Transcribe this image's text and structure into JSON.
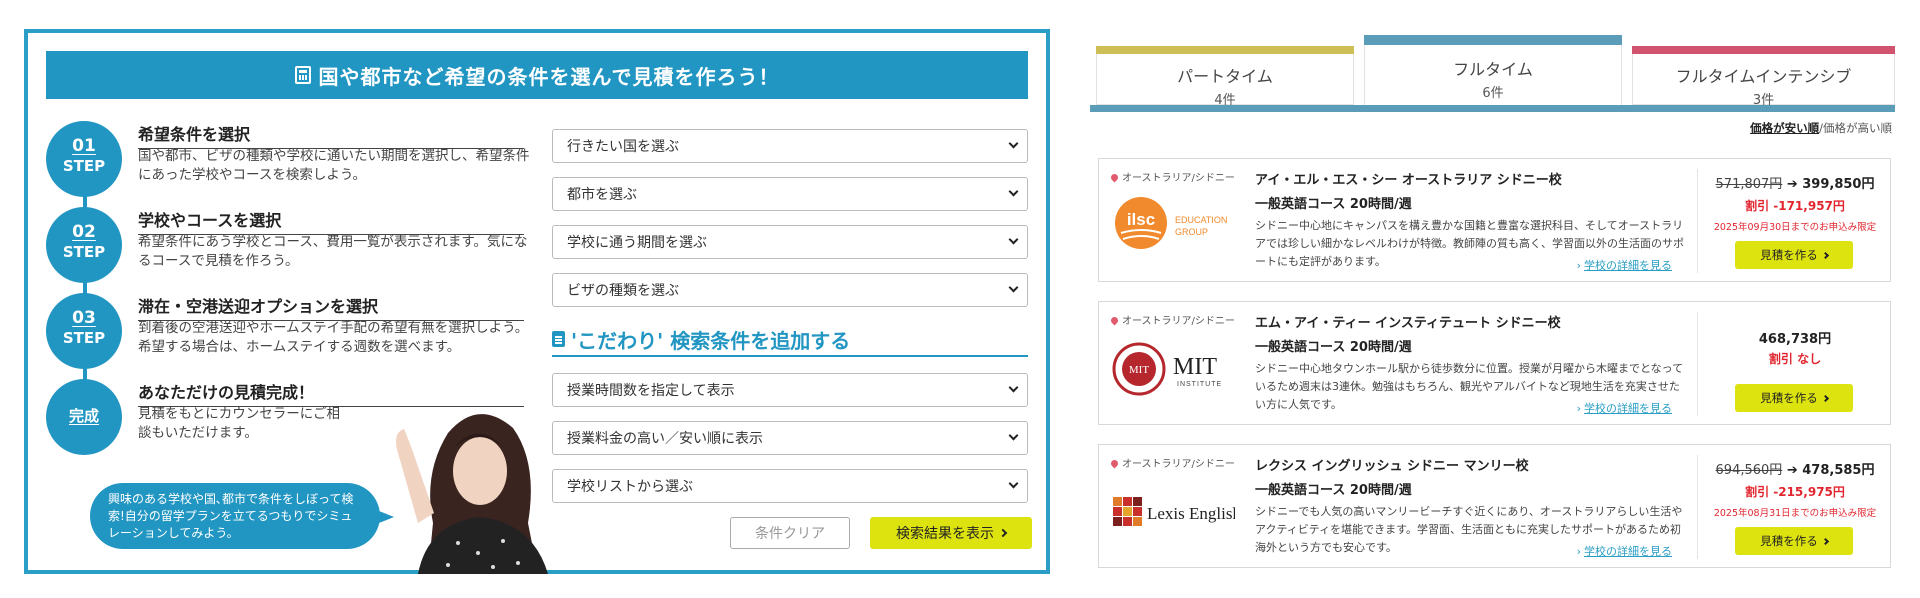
{
  "search_panel": {
    "banner_title": "国や都市など希望の条件を選んで見積を作ろう！",
    "steps": [
      {
        "num": "01",
        "label": "STEP",
        "title": "希望条件を選択",
        "desc": "国や都市、ビザの種類や学校に通いたい期間を選択し、希望条件にあった学校やコースを検索しよう。"
      },
      {
        "num": "02",
        "label": "STEP",
        "title": "学校やコースを選択",
        "desc": "希望条件にあう学校とコース、費用一覧が表示されます。気になるコースで見積を作ろう。"
      },
      {
        "num": "03",
        "label": "STEP",
        "title": "滞在・空港送迎オプションを選択",
        "desc": "到着後の空港送迎やホームステイ手配の希望有無を選択しよう。希望する場合は、ホームステイする週数を選べます。"
      },
      {
        "num": "",
        "label": "完成",
        "title": "あなただけの見積完成！",
        "desc": "見積をもとにカウンセラーにご相談もいただけます。"
      }
    ],
    "bubble_text": "興味のある学校や国､都市で条件をしぼって検索!自分の留学プランを立てるつもりでシミュレーションしてみよう。",
    "selects": [
      "行きたい国を選ぶ",
      "都市を選ぶ",
      "学校に通う期間を選ぶ",
      "ビザの種類を選ぶ"
    ],
    "kodawari_title": "'こだわり' 検索条件を追加する",
    "kodawari_selects": [
      "授業時間数を指定して表示",
      "授業料金の高い／安い順に表示",
      "学校リストから選ぶ"
    ],
    "clear_label": "条件クリア",
    "search_label": "検索結果を表示"
  },
  "results": {
    "tabs": [
      {
        "name": "パートタイム",
        "count": "4件",
        "color": "#cdbf55"
      },
      {
        "name": "フルタイム",
        "count": "6件",
        "color": "#5b9db9"
      },
      {
        "name": "フルタイムインテンシブ",
        "count": "3件",
        "color": "#d2536e"
      }
    ],
    "sort": {
      "active": "価格が安い順",
      "separator": "/",
      "other": "価格が高い順"
    },
    "schools": [
      {
        "location": "オーストラリア/シドニー",
        "logo": "ilsc-logo",
        "name": "アイ・エル・エス・シー オーストラリア シドニー校",
        "course": "一般英語コース 20時間/週",
        "desc": "シドニー中心地にキャンパスを構え豊かな国籍と豊富な選択科目、そしてオーストラリアでは珍しい細かなレベルわけが特徴。教師陣の質も高く、学習面以外の生活面のサポートにも定評があります。",
        "detail": "学校の詳細を見る",
        "price_old": "571,807円",
        "price_new": "399,850円",
        "discount": "割引 -171,957円",
        "limit": "2025年09月30日までのお申込み限定",
        "button": "見積を作る"
      },
      {
        "location": "オーストラリア/シドニー",
        "logo": "mit-logo",
        "name": "エム・アイ・ティー インスティテュート シドニー校",
        "course": "一般英語コース 20時間/週",
        "desc": "シドニー中心地タウンホール駅から徒歩数分に位置。授業が月曜から木曜までとなっているため週末は3連休。勉強はもちろん、観光やアルバイトなど現地生活を充実させたい方に人気です。",
        "detail": "学校の詳細を見る",
        "price_old": "",
        "price_new": "468,738円",
        "discount": "割引 なし",
        "limit": "",
        "button": "見積を作る"
      },
      {
        "location": "オーストラリア/シドニー",
        "logo": "lexis-logo",
        "name": "レクシス イングリッシュ シドニー マンリー校",
        "course": "一般英語コース 20時間/週",
        "desc": "シドニーでも人気の高いマンリービーチすぐ近くにあり、オーストラリアらしい生活やアクティビティを堪能できます。学習面、生活面ともに充実したサポートがあるため初海外という方でも安心です。",
        "detail": "学校の詳細を見る",
        "price_old": "694,560円",
        "price_new": "478,585円",
        "discount": "割引 -215,975円",
        "limit": "2025年08月31日までのお申込み限定",
        "button": "見積を作る"
      }
    ],
    "logo_text": {
      "ilsc": "ilsc",
      "ilsc_sub1": "EDUCATION",
      "ilsc_sub2": "GROUP",
      "mit": "MIT",
      "mit_sub": "INSTITUTE",
      "mit_emblem": "MIT",
      "lexis": "Lexis English"
    }
  },
  "colors": {
    "primary": "#2296c2",
    "accent_yellow": "#dde30e",
    "discount_red": "#e2262f"
  }
}
